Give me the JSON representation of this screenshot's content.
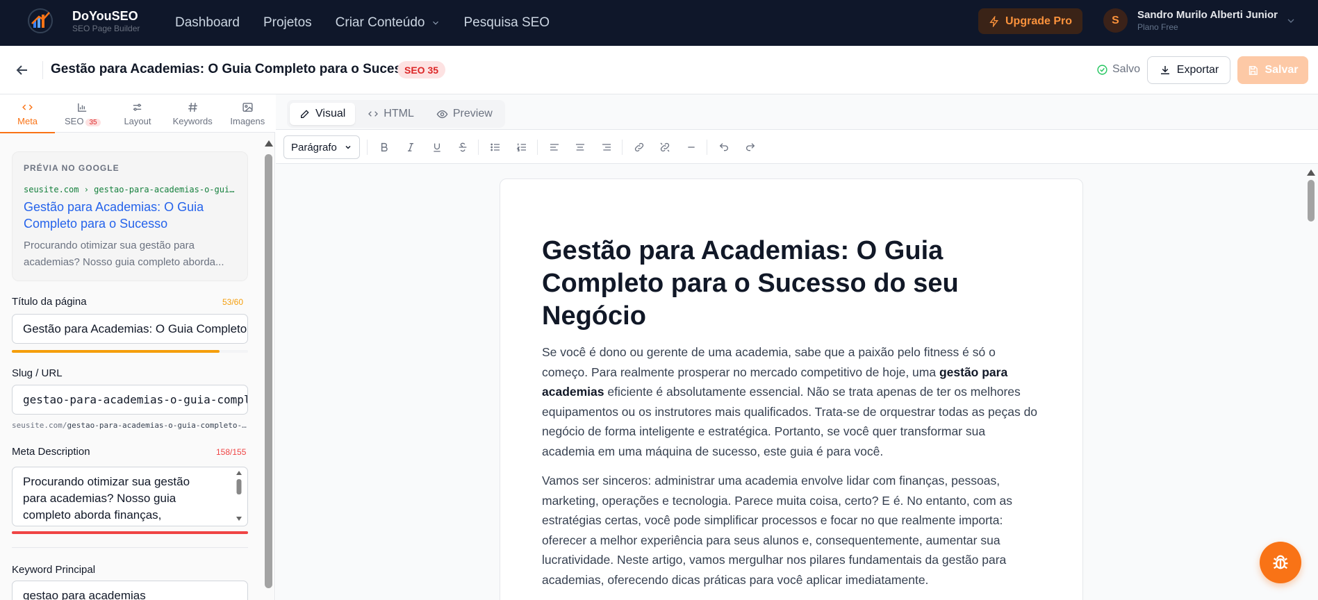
{
  "brand": {
    "name": "DoYouSEO",
    "subtitle": "SEO Page Builder"
  },
  "nav": {
    "links": [
      "Dashboard",
      "Projetos",
      "Criar Conteúdo",
      "Pesquisa SEO"
    ],
    "upgrade_label": "Upgrade Pro"
  },
  "user": {
    "initial": "S",
    "name": "Sandro Murilo Alberti Junior",
    "plan": "Plano Free"
  },
  "header": {
    "title": "Gestão para Academias: O Guia Completo para o Sucesso",
    "seo_badge": "SEO 35",
    "saved_label": "Salvo",
    "export_label": "Exportar",
    "save_label": "Salvar"
  },
  "sidebar": {
    "tabs": [
      {
        "label": "Meta",
        "icon": "code-icon"
      },
      {
        "label": "SEO",
        "badge": "35",
        "icon": "bar-chart-icon"
      },
      {
        "label": "Layout",
        "icon": "sliders-icon"
      },
      {
        "label": "Keywords",
        "icon": "hash-icon"
      },
      {
        "label": "Imagens",
        "icon": "image-icon"
      }
    ],
    "google_preview": {
      "label": "PRÉVIA NO GOOGLE",
      "url": "seusite.com › gestao-para-academias-o-guia-completo-para-o-sucesso",
      "title": "Gestão para Academias: O Guia Completo para o Sucesso",
      "description": "Procurando otimizar sua gestão para academias? Nosso guia completo aborda..."
    },
    "page_title": {
      "label": "Título da página",
      "count": "53/60",
      "value": "Gestão para Academias: O Guia Completo para o Sucesso",
      "progress": 0.88
    },
    "slug": {
      "label": "Slug / URL",
      "value": "gestao-para-academias-o-guia-completo-para-o-sucesso",
      "hint_domain": "seusite.com/",
      "hint_path": "gestao-para-academias-o-guia-completo-para-o-sucesso"
    },
    "meta_description": {
      "label": "Meta Description",
      "count": "158/155",
      "value": "Procurando otimizar sua gestão para academias? Nosso guia completo aborda finanças,",
      "progress": 1.0
    },
    "keyword": {
      "label": "Keyword Principal",
      "value": "gestao para academias"
    }
  },
  "editor": {
    "modes": [
      "Visual",
      "HTML",
      "Preview"
    ],
    "format_select": "Parágrafo",
    "content": {
      "heading": "Gestão para Academias: O Guia Completo para o Sucesso do seu Negócio",
      "p1_before": "Se você é dono ou gerente de uma academia, sabe que a paixão pelo fitness é só o começo. Para realmente prosperar no mercado competitivo de hoje, uma ",
      "p1_bold": "gestão para academias",
      "p1_after": " eficiente é absolutamente essencial. Não se trata apenas de ter os melhores equipamentos ou os instrutores mais qualificados. Trata-se de orquestrar todas as peças do negócio de forma inteligente e estratégica. Portanto, se você quer transformar sua academia em uma máquina de sucesso, este guia é para você.",
      "p2": "Vamos ser sinceros: administrar uma academia envolve lidar com finanças, pessoas, marketing, operações e tecnologia. Parece muita coisa, certo? E é. No entanto, com as estratégias certas, você pode simplificar processos e focar no que realmente importa: oferecer a melhor experiência para seus alunos e, consequentemente, aumentar sua lucratividade. Neste artigo, vamos mergulhar nos pilares fundamentais da gestão para academias, oferecendo dicas práticas para você aplicar imediatamente."
    }
  },
  "colors": {
    "accent": "#f97316",
    "nav_bg": "#0f172a",
    "danger": "#dc2626",
    "warning": "#f59e0b",
    "link": "#2563eb"
  }
}
